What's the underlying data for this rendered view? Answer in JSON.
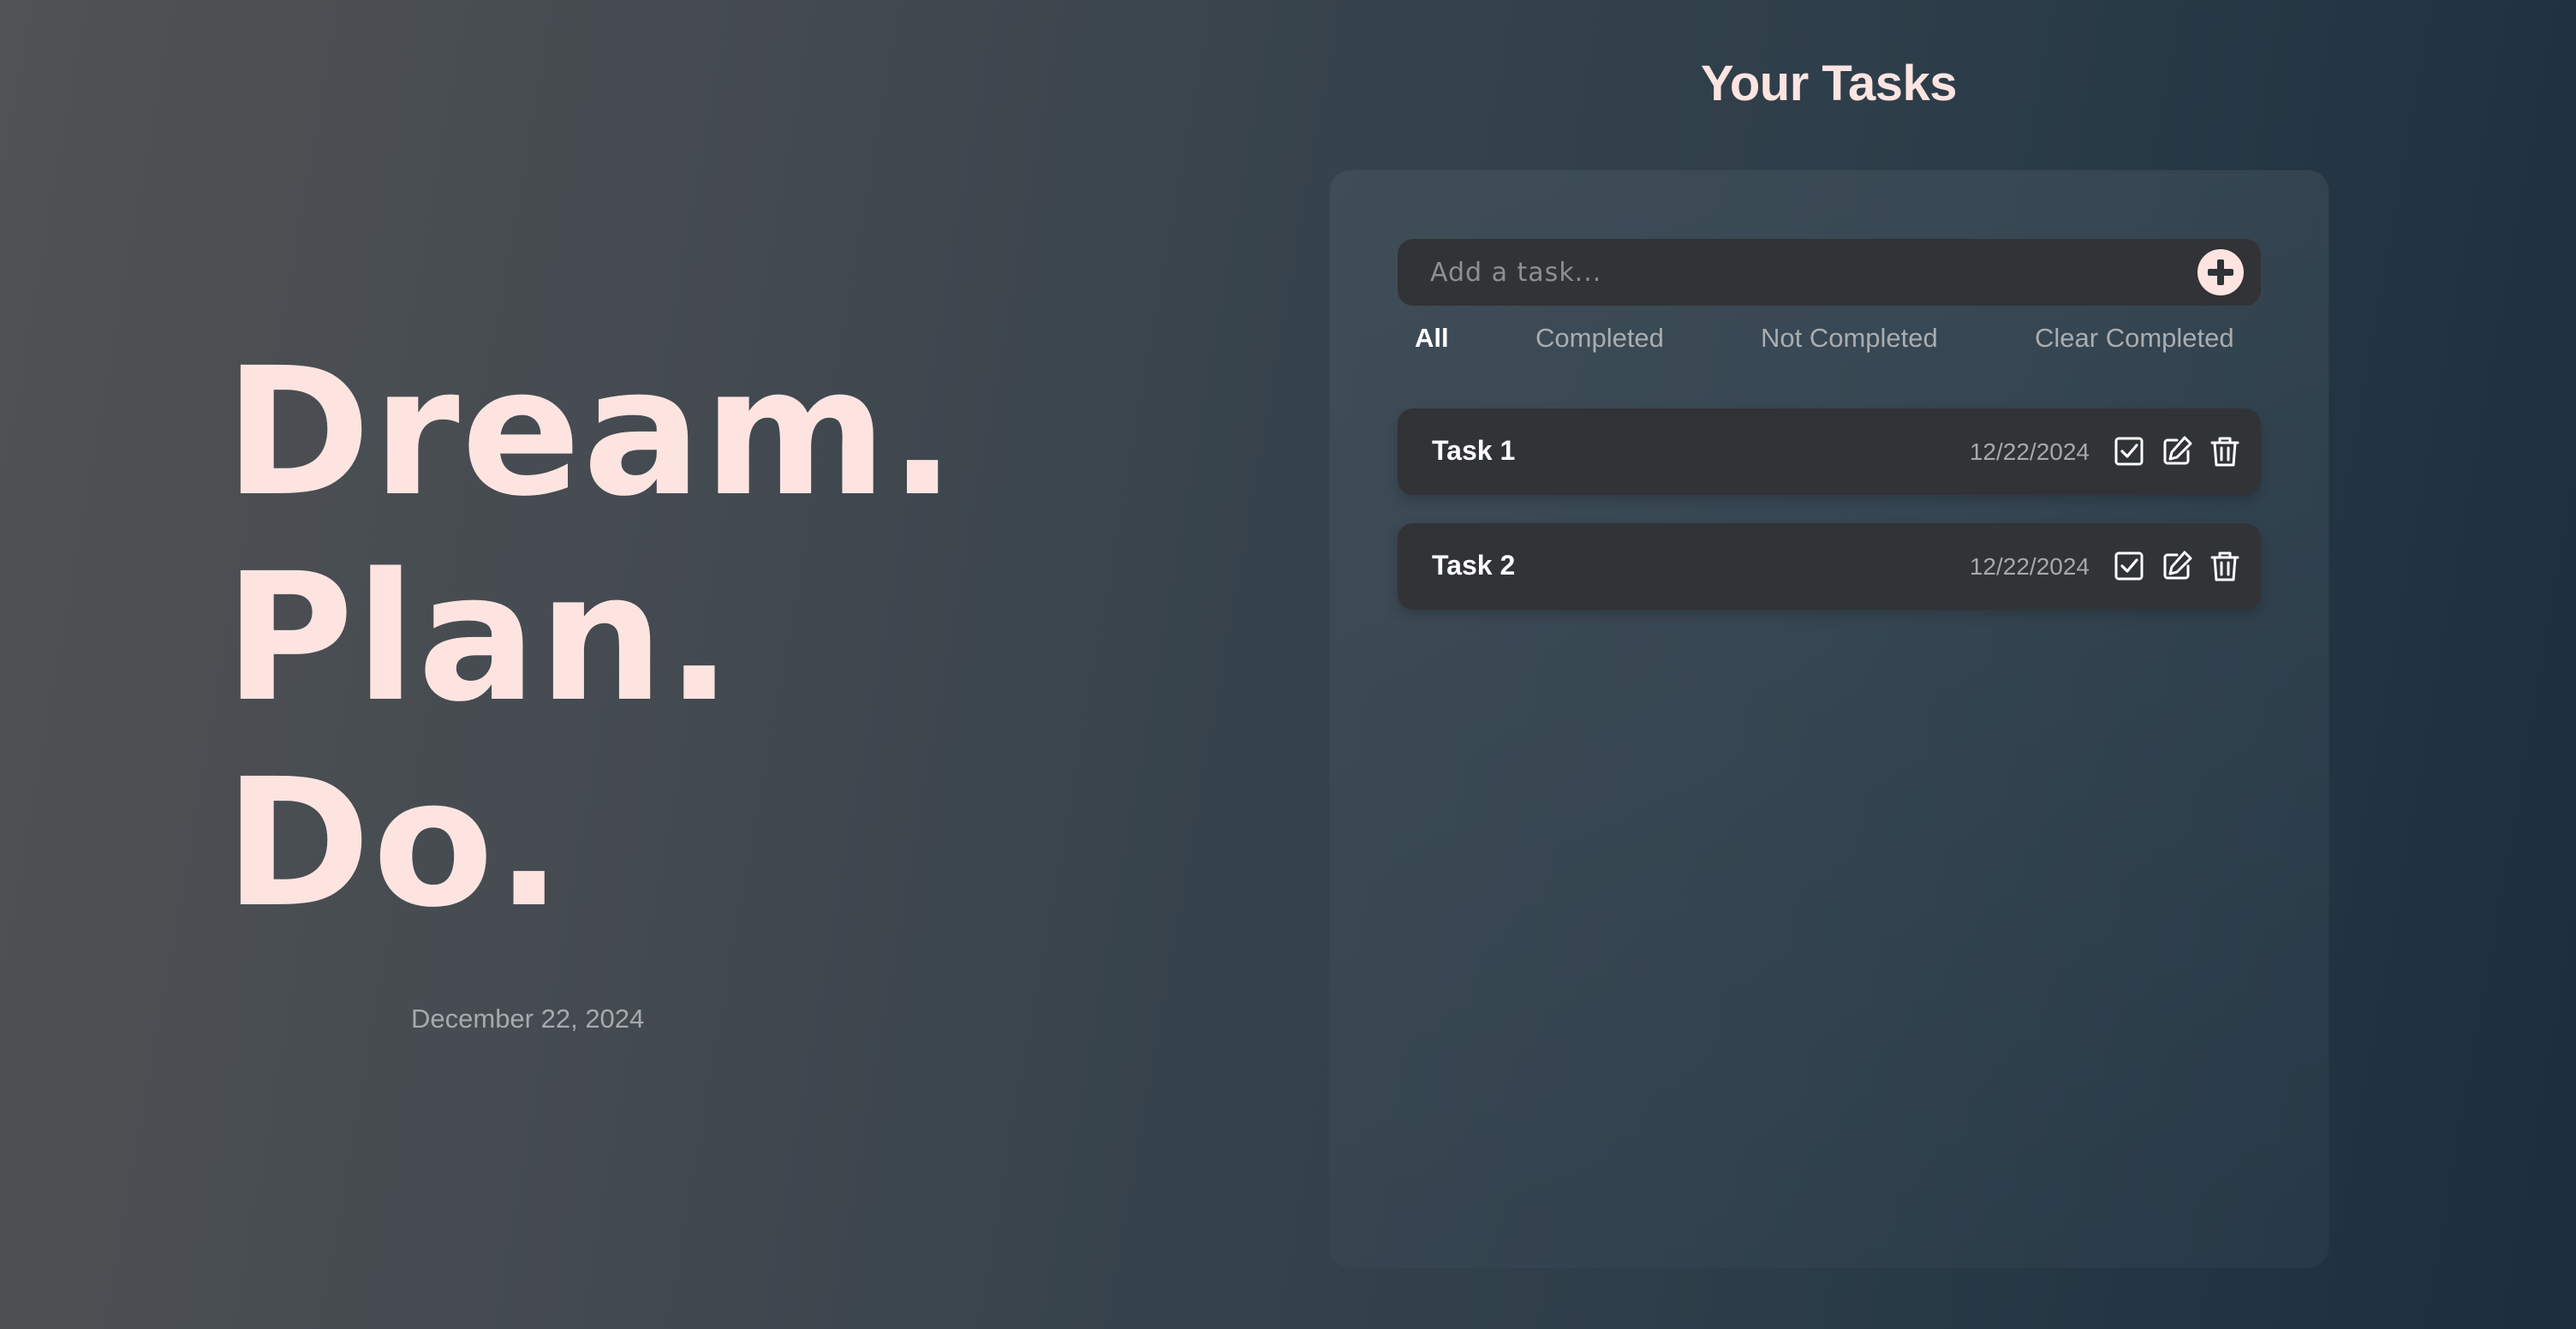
{
  "hero": {
    "lines": [
      "Dream.",
      "Plan.",
      "Do."
    ],
    "date": "December 22, 2024"
  },
  "tasks_panel": {
    "title": "Your Tasks",
    "input": {
      "placeholder": "Add a task...",
      "value": ""
    },
    "add_button_icon": "plus-circle-icon",
    "filters": [
      {
        "label": "All",
        "active": true
      },
      {
        "label": "Completed",
        "active": false
      },
      {
        "label": "Not Completed",
        "active": false
      },
      {
        "label": "Clear Completed",
        "active": false
      }
    ],
    "tasks": [
      {
        "name": "Task 1",
        "date": "12/22/2024",
        "icons": [
          "checkbox-icon",
          "edit-icon",
          "trash-icon"
        ]
      },
      {
        "name": "Task 2",
        "date": "12/22/2024",
        "icons": [
          "checkbox-icon",
          "edit-icon",
          "trash-icon"
        ]
      }
    ]
  },
  "colors": {
    "accent": "#fde4e1",
    "card": "#313336",
    "muted_text": "#a7aaad"
  }
}
